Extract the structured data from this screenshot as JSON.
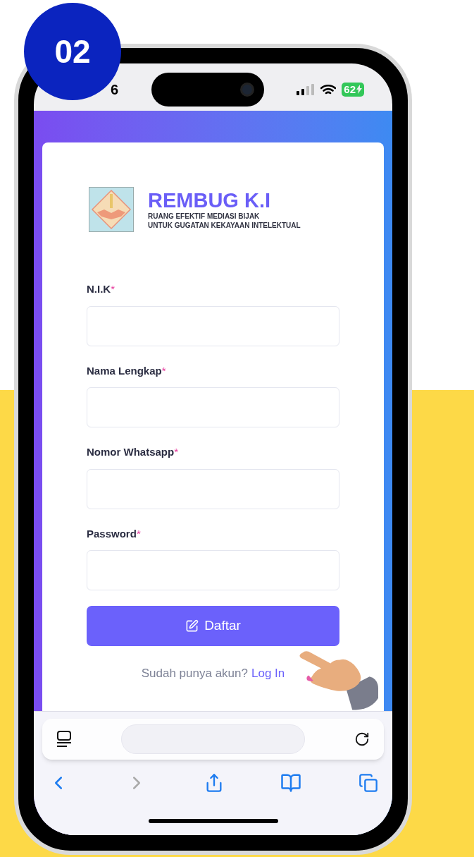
{
  "badge": "02",
  "status_bar": {
    "time": "6",
    "battery": "62"
  },
  "app": {
    "title": "REMBUG K.I",
    "subtitle_lines": [
      "RUANG EFEKTIF MEDIASI BIJAK",
      "UNTUK GUGATAN KEKAYAAN INTELEKTUAL"
    ]
  },
  "fields": [
    {
      "label": "N.I.K",
      "required_mark": "*"
    },
    {
      "label": "Nama Lengkap",
      "required_mark": "*"
    },
    {
      "label": "Nomor Whatsapp",
      "required_mark": "*"
    },
    {
      "label": "Password",
      "required_mark": "*"
    }
  ],
  "submit_button": "Daftar",
  "login_prompt": {
    "text": "Sudah punya akun?",
    "link": "Log In"
  },
  "browser_toolbar": {
    "back_disabled": false,
    "forward_disabled": true
  }
}
